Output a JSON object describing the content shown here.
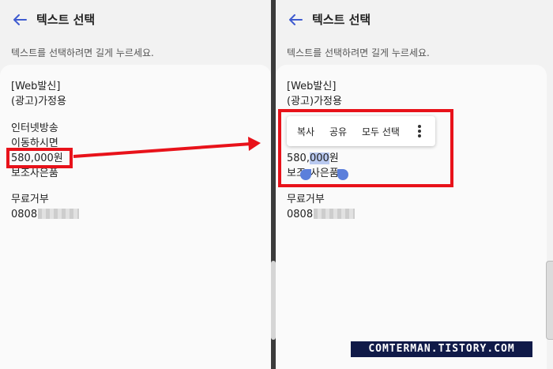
{
  "header": {
    "title": "텍스트 선택",
    "subtitle": "텍스트를 선택하려면 길게 누르세요."
  },
  "message": {
    "line1": "[Web발신]",
    "line2": "(광고)가정용",
    "line3": "인터넷방송",
    "line4": "이동하시면",
    "price": "580,000원",
    "price_prefix": "580,",
    "price_selected": "000",
    "price_suffix": "원",
    "line6": "보조사은품",
    "line6_partial_a": "보조",
    "line6_partial_b": "사은품",
    "optout_label": "무료거부",
    "optout_number": "0808"
  },
  "context_menu": {
    "copy": "복사",
    "share": "공유",
    "select_all": "모두 선택"
  },
  "colors": {
    "highlight": "#e8121a",
    "selection": "#b9c9f0",
    "handle": "#5b7fdb",
    "accent": "#3f5bd0"
  },
  "icons": {
    "back": "arrow-left-icon",
    "more": "more-vert-icon"
  },
  "watermark": "COMTERMAN.TISTORY.COM"
}
